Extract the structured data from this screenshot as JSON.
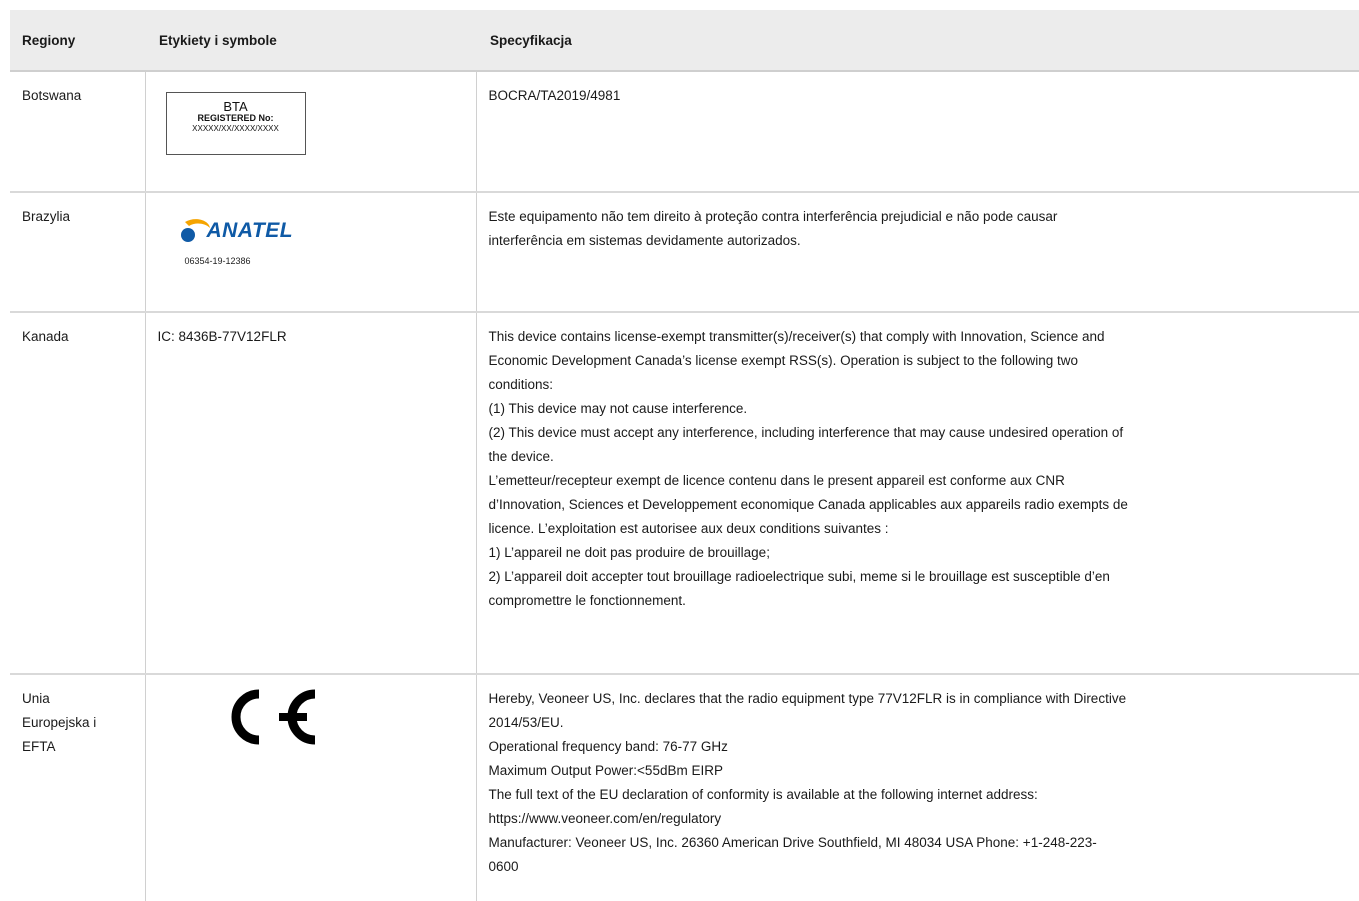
{
  "table": {
    "headers": [
      "Regiony",
      "Etykiety i symbole",
      "Specyfikacja"
    ],
    "rows": [
      {
        "region": "Botswana",
        "label": {
          "line1": "BTA",
          "line2": "REGISTERED No:",
          "line3": "XXXXX/XX/XXXX/XXXX"
        },
        "spec": [
          "BOCRA/TA2019/4981"
        ]
      },
      {
        "region": "Brazylia",
        "label": {
          "brand": "ANATEL",
          "code": "06354-19-12386",
          "brand_color": "#0f5aa6",
          "accent_color": "#f5a400"
        },
        "spec": [
          "Este equipamento não tem direito à proteção contra interferência prejudicial e não pode causar",
          "interferência em sistemas devidamente autorizados."
        ]
      },
      {
        "region": "Kanada",
        "label": {
          "text": "IC: 8436B-77V12FLR"
        },
        "spec": [
          "This device contains license-exempt transmitter(s)/receiver(s) that comply with Innovation, Science and",
          "Economic Development Canada’s license exempt RSS(s). Operation is subject to the following two",
          "conditions:",
          "(1) This device may not cause interference.",
          "(2) This device must accept any interference, including interference that may cause undesired operation of",
          "the device.",
          "L’emetteur/recepteur exempt de licence contenu dans le present appareil est conforme aux CNR",
          "d’Innovation, Sciences et Developpement economique Canada applicables aux appareils radio exempts de",
          "licence. L’exploitation est autorisee aux deux conditions suivantes :",
          "1) L’appareil ne doit pas produire de brouillage;",
          "2) L’appareil doit accepter tout brouillage radioelectrique subi, meme si le brouillage est susceptible d’en",
          "compromettre le fonctionnement."
        ]
      },
      {
        "region_lines": [
          "Unia",
          "Europejska i",
          "EFTA"
        ],
        "label": {
          "mark": "CE"
        },
        "spec": [
          "Hereby, Veoneer US, Inc. declares that the radio equipment type 77V12FLR is in compliance with Directive",
          "2014/53/EU.",
          "Operational frequency band: 76-77 GHz",
          "Maximum Output Power:<55dBm EIRP",
          "The full text of the EU declaration of conformity is available at the following internet address:",
          "https://www.veoneer.com/en/regulatory",
          "Manufacturer: Veoneer US, Inc. 26360 American Drive Southfield, MI 48034 USA Phone: +1-248-223-",
          "0600"
        ]
      }
    ]
  }
}
